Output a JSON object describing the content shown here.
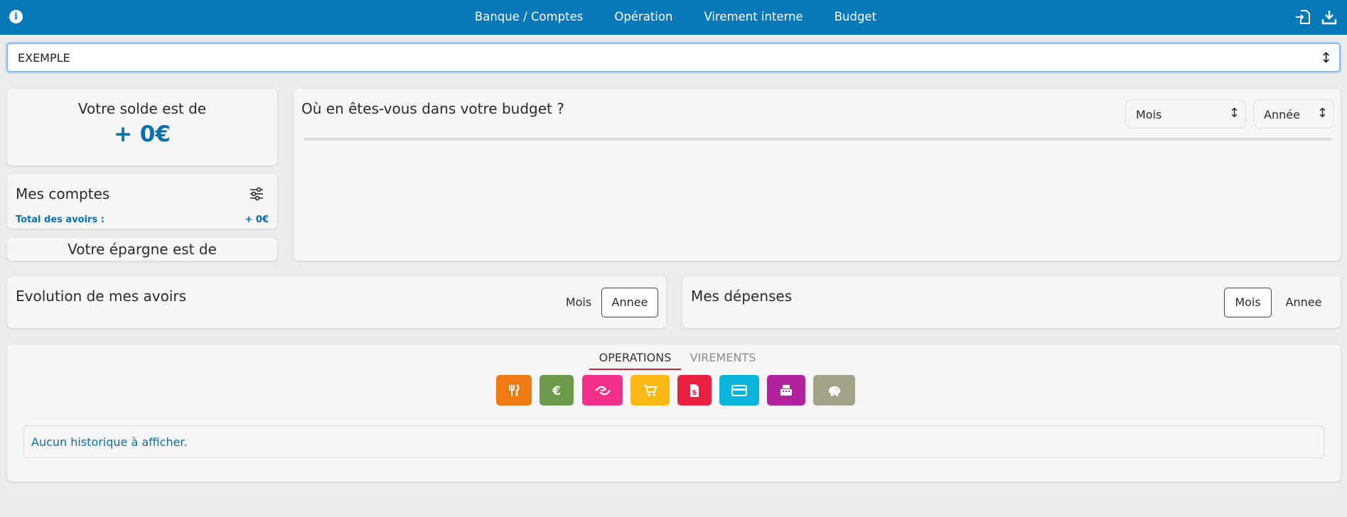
{
  "nav": {
    "links": [
      "Banque / Comptes",
      "Opération",
      "Virement interne",
      "Budget"
    ]
  },
  "account_select": {
    "value": "EXEMPLE"
  },
  "solde": {
    "label": "Votre solde est de",
    "amount": "+ 0€"
  },
  "comptes": {
    "title": "Mes comptes",
    "total_label": "Total des avoirs :",
    "total_value": "+ 0€"
  },
  "epargne": {
    "label": "Votre épargne est de"
  },
  "budget": {
    "title": "Où en êtes-vous dans votre budget ?",
    "month_select": "Mois",
    "year_select": "Année"
  },
  "evolution": {
    "title": "Evolution de mes avoirs",
    "toggle": [
      "Mois",
      "Annee"
    ],
    "active": "Annee"
  },
  "depenses": {
    "title": "Mes dépenses",
    "toggle": [
      "Mois",
      "Annee"
    ],
    "active": "Mois"
  },
  "history": {
    "tabs": [
      "OPERATIONS",
      "VIREMENTS"
    ],
    "active_tab": "OPERATIONS",
    "categories": [
      {
        "icon": "restaurant-icon",
        "color": "#f07a12"
      },
      {
        "icon": "euro-icon",
        "color": "#6d9a4a"
      },
      {
        "icon": "handshake-icon",
        "color": "#f2308a"
      },
      {
        "icon": "shopping-cart-icon",
        "color": "#fdb913"
      },
      {
        "icon": "invoice-icon",
        "color": "#ea2040"
      },
      {
        "icon": "credit-card-icon",
        "color": "#09b4da"
      },
      {
        "icon": "cash-register-icon",
        "color": "#b2229d"
      },
      {
        "icon": "piggy-bank-icon",
        "color": "#a2a38a"
      }
    ],
    "empty_message": "Aucun historique à afficher."
  },
  "colors": {
    "nav": "#0778b8",
    "accent": "#0770ae",
    "tab_underline": "#c0243a"
  }
}
